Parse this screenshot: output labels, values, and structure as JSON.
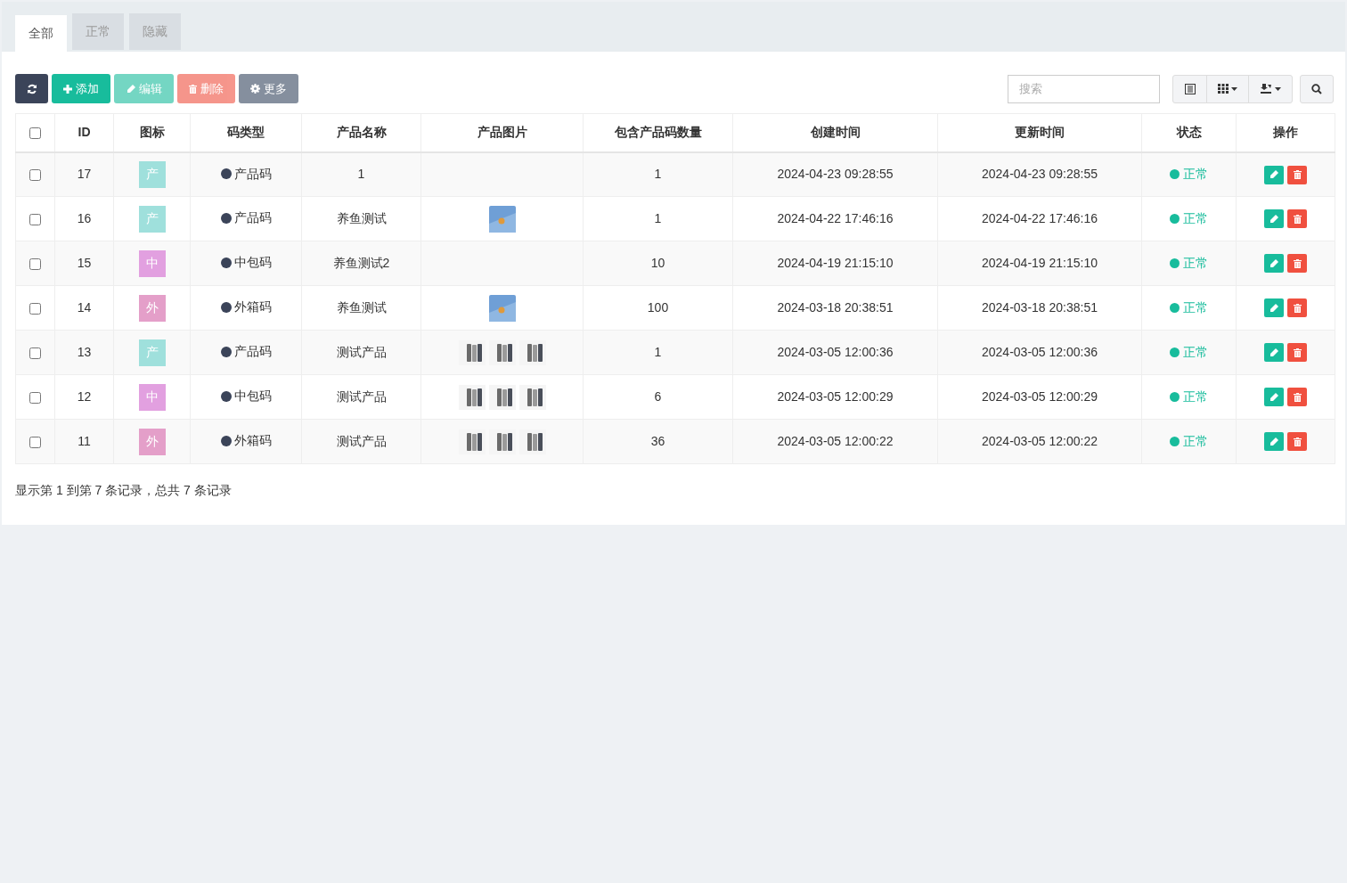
{
  "tabs": [
    {
      "label": "全部",
      "selected": true
    },
    {
      "label": "正常",
      "selected": false
    },
    {
      "label": "隐藏",
      "selected": false
    }
  ],
  "toolbar": [
    {
      "kind": "refresh",
      "disabled": false
    },
    {
      "kind": "add",
      "label": "添加",
      "disabled": false
    },
    {
      "kind": "edit",
      "label": "编辑",
      "disabled": true
    },
    {
      "kind": "delete",
      "label": "删除",
      "disabled": true
    },
    {
      "kind": "more",
      "label": "更多",
      "disabled": false
    }
  ],
  "search": {
    "placeholder": "搜索"
  },
  "select_all": {
    "checked": false
  },
  "columns": [
    "ID",
    "图标",
    "码类型",
    "产品名称",
    "产品图片",
    "包含产品码数量",
    "创建时间",
    "更新时间",
    "状态",
    "操作"
  ],
  "rows": [
    {
      "checked": false,
      "id": "17",
      "icon": "产",
      "color": "#9fe0dc",
      "type": "产品码",
      "name": "1",
      "images": [],
      "qty": "1",
      "created": "2024-04-23 09:28:55",
      "updated": "2024-04-23 09:28:55",
      "status": "正常"
    },
    {
      "checked": false,
      "id": "16",
      "icon": "产",
      "color": "#9fe0dc",
      "type": "产品码",
      "name": "养鱼测试",
      "images": [
        {
          "kind": "sky"
        }
      ],
      "qty": "1",
      "created": "2024-04-22 17:46:16",
      "updated": "2024-04-22 17:46:16",
      "status": "正常"
    },
    {
      "checked": false,
      "id": "15",
      "icon": "中",
      "color": "#e2a0e0",
      "type": "中包码",
      "name": "养鱼测试2",
      "images": [],
      "qty": "10",
      "created": "2024-04-19 21:15:10",
      "updated": "2024-04-19 21:15:10",
      "status": "正常"
    },
    {
      "checked": false,
      "id": "14",
      "icon": "外",
      "color": "#e49fc9",
      "type": "外箱码",
      "name": "养鱼测试",
      "images": [
        {
          "kind": "sky"
        }
      ],
      "qty": "100",
      "created": "2024-03-18 20:38:51",
      "updated": "2024-03-18 20:38:51",
      "status": "正常"
    },
    {
      "checked": false,
      "id": "13",
      "icon": "产",
      "color": "#9fe0dc",
      "type": "产品码",
      "name": "测试产品",
      "images": [
        {
          "kind": "phone"
        },
        {
          "kind": "phone"
        },
        {
          "kind": "phone"
        }
      ],
      "qty": "1",
      "created": "2024-03-05 12:00:36",
      "updated": "2024-03-05 12:00:36",
      "status": "正常"
    },
    {
      "checked": false,
      "id": "12",
      "icon": "中",
      "color": "#e2a0e0",
      "type": "中包码",
      "name": "测试产品",
      "images": [
        {
          "kind": "phone"
        },
        {
          "kind": "phone"
        },
        {
          "kind": "phone"
        }
      ],
      "qty": "6",
      "created": "2024-03-05 12:00:29",
      "updated": "2024-03-05 12:00:29",
      "status": "正常"
    },
    {
      "checked": false,
      "id": "11",
      "icon": "外",
      "color": "#e49fc9",
      "type": "外箱码",
      "name": "测试产品",
      "images": [
        {
          "kind": "phone"
        },
        {
          "kind": "phone"
        },
        {
          "kind": "phone"
        }
      ],
      "qty": "36",
      "created": "2024-03-05 12:00:22",
      "updated": "2024-03-05 12:00:22",
      "status": "正常"
    }
  ],
  "footer": "显示第 1 到第 7 条记录，总共 7 条记录"
}
